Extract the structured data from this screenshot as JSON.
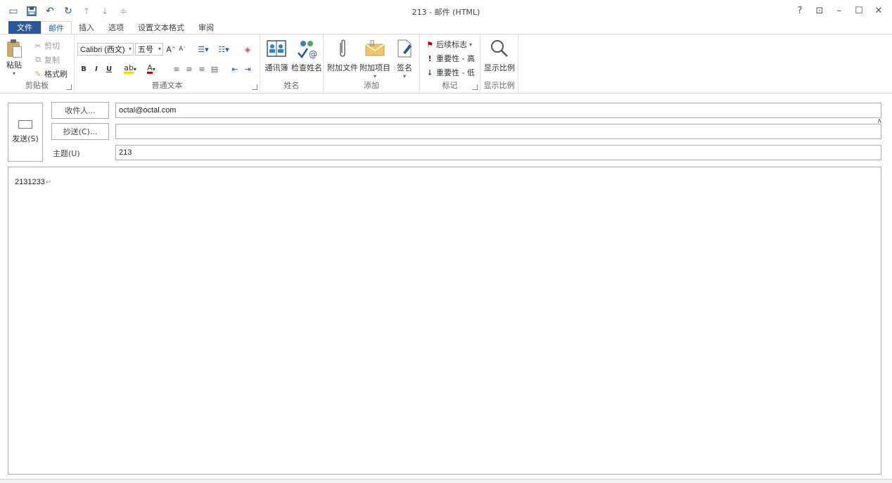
{
  "window": {
    "title": "213 - 邮件 (HTML)",
    "controls": {
      "help": "?",
      "ribbon_opts": "⊡",
      "minimize": "–",
      "maximize": "☐",
      "close": "✕"
    }
  },
  "tabs": [
    {
      "label": "文件"
    },
    {
      "label": "邮件"
    },
    {
      "label": "插入"
    },
    {
      "label": "选项"
    },
    {
      "label": "设置文本格式"
    },
    {
      "label": "审阅"
    }
  ],
  "ribbon": {
    "clipboard": {
      "paste": "粘贴",
      "cut": "剪切",
      "copy": "复制",
      "format_painter": "格式刷",
      "group_label": "剪贴板"
    },
    "basic_text": {
      "font_name": "Calibri (西文)",
      "font_size": "五号",
      "group_label": "普通文本"
    },
    "names": {
      "address_book": "通讯簿",
      "check_names": "检查姓名",
      "group_label": "姓名"
    },
    "include": {
      "attach_file": "附加文件",
      "attach_item": "附加项目",
      "signature": "签名",
      "group_label": "添加"
    },
    "tags": {
      "follow_up": "后续标志",
      "high_importance": "重要性 - 高",
      "low_importance": "重要性 - 低",
      "group_label": "标记"
    },
    "zoom": {
      "zoom": "显示比例",
      "group_label": "显示比例"
    }
  },
  "message": {
    "send": "发送(S)",
    "to_button": "收件人...",
    "cc_button": "抄送(C)...",
    "subject_label": "主题(U)",
    "to_value": "octal@octal.com",
    "cc_value": "",
    "subject_value": "213",
    "body_text": "2131233"
  },
  "colors": {
    "accent": "#2b579a",
    "highlight": "#ffd400",
    "font_color": "#c00000",
    "importance_high": "#c00000",
    "importance_low": "#2b579a"
  }
}
